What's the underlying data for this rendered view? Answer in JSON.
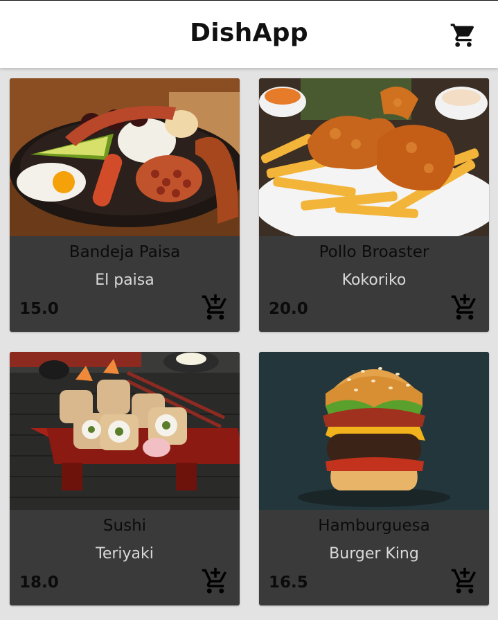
{
  "app": {
    "title": "DishApp",
    "cart_icon": "cart-icon"
  },
  "colors": {
    "card_background": "#3a3a3a",
    "page_background": "#e3e3e3",
    "topbar_background": "#ffffff"
  },
  "dishes": [
    {
      "name": "Bandeja Paisa",
      "restaurant": "El paisa",
      "price": "15.0",
      "add_icon": "add-to-cart-icon"
    },
    {
      "name": "Pollo Broaster",
      "restaurant": "Kokoriko",
      "price": "20.0",
      "add_icon": "add-to-cart-icon"
    },
    {
      "name": "Sushi",
      "restaurant": "Teriyaki",
      "price": "18.0",
      "add_icon": "add-to-cart-icon"
    },
    {
      "name": "Hamburguesa",
      "restaurant": "Burger King",
      "price": "16.5",
      "add_icon": "add-to-cart-icon"
    }
  ]
}
